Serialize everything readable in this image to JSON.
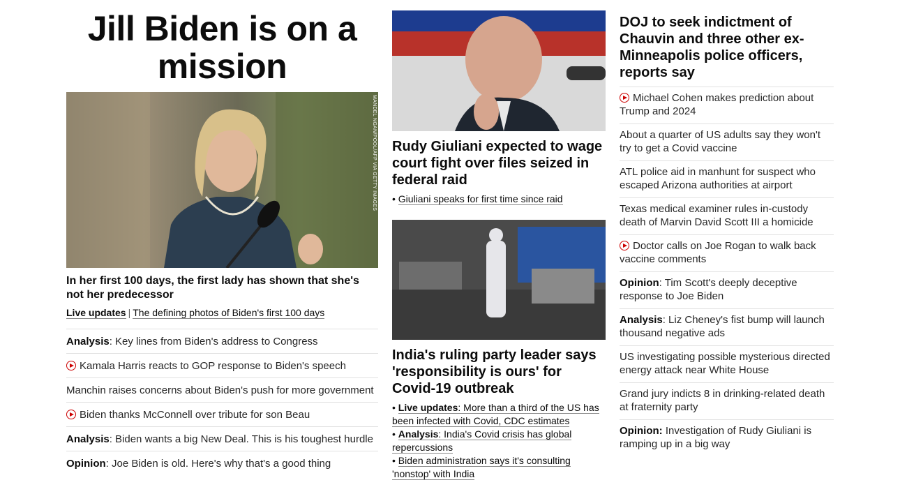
{
  "col1": {
    "hero_title": "Jill Biden is on a mission",
    "photo_credit": "MANDEL NGAN/POOL/AFP VIA GETTY IMAGES",
    "hero_sub": "In her first 100 days, the first lady has shown that she's not her predecessor",
    "live_label": "Live updates",
    "separator": "|",
    "photos_link": "The defining photos of Biden's first 100 days",
    "items": [
      {
        "label": "Analysis",
        "text": ": Key lines from Biden's address to Congress",
        "video": false
      },
      {
        "label": "",
        "text": "Kamala Harris reacts to GOP response to Biden's speech",
        "video": true
      },
      {
        "label": "",
        "text": "Manchin raises concerns about Biden's push for more government",
        "video": false
      },
      {
        "label": "",
        "text": "Biden thanks McConnell over tribute for son Beau",
        "video": true
      },
      {
        "label": "Analysis",
        "text": ": Biden wants a big New Deal. This is his toughest hurdle",
        "video": false
      },
      {
        "label": "Opinion",
        "text": ": Joe Biden is old. Here's why that's a good thing",
        "video": false
      }
    ]
  },
  "col2": {
    "story1": {
      "headline": "Rudy Giuliani expected to wage court fight over files seized in federal raid",
      "bullet": "Giuliani speaks for first time since raid"
    },
    "story2": {
      "headline": "India's ruling party leader says 'responsibility is ours' for Covid-19 outbreak",
      "bullets": [
        {
          "label": "Live updates",
          "text": ": More than a third of the US has been infected with Covid, CDC estimates"
        },
        {
          "label": "Analysis",
          "text": ": India's Covid crisis has global repercussions"
        },
        {
          "label": "",
          "text": "Biden administration says it's consulting 'nonstop' with India"
        }
      ]
    }
  },
  "col3": {
    "headline": "DOJ to seek indictment of Chauvin and three other ex-Minneapolis police officers, reports say",
    "items": [
      {
        "label": "",
        "text": "Michael Cohen makes prediction about Trump and 2024",
        "video": true
      },
      {
        "label": "",
        "text": "About a quarter of US adults say they won't try to get a Covid vaccine",
        "video": false
      },
      {
        "label": "",
        "text": "ATL police aid in manhunt for suspect who escaped Arizona authorities at airport",
        "video": false
      },
      {
        "label": "",
        "text": "Texas medical examiner rules in-custody death of Marvin David Scott III a homicide",
        "video": false
      },
      {
        "label": "",
        "text": "Doctor calls on Joe Rogan to walk back vaccine comments",
        "video": true
      },
      {
        "label": "Opinion",
        "text": ": Tim Scott's deeply deceptive response to Joe Biden",
        "video": false
      },
      {
        "label": "Analysis",
        "text": ": Liz Cheney's fist bump will launch thousand negative ads",
        "video": false
      },
      {
        "label": "",
        "text": "US investigating possible mysterious directed energy attack near White House",
        "video": false
      },
      {
        "label": "",
        "text": "Grand jury indicts 8 in drinking-related death at fraternity party",
        "video": false
      },
      {
        "label": "Opinion:",
        "text": " Investigation of Rudy Giuliani is ramping up in a big way",
        "video": false
      }
    ]
  },
  "colors": {
    "accent": "#cc0000",
    "text": "#0c0c0c",
    "divider": "#e1e1e1"
  }
}
